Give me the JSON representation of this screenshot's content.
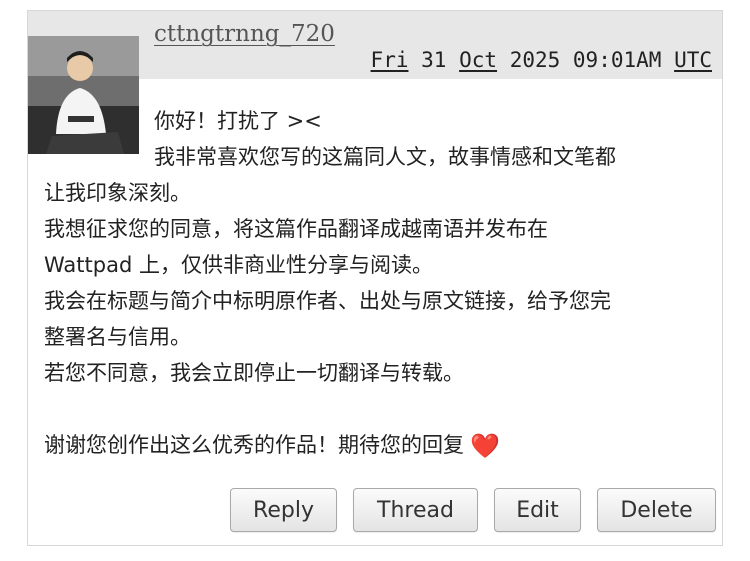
{
  "comment": {
    "username": "cttngtrnng_720",
    "timestamp": {
      "weekday": "Fri",
      "day": "31",
      "month": "Oct",
      "year_time": "2025 09:01AM",
      "zone": "UTC"
    },
    "avatar_icon": "user-photo-avatar",
    "body": {
      "line1": "你好！打扰了 ><",
      "line2": "我非常喜欢您写的这篇同人文，故事情感和文笔都",
      "line3": "让我印象深刻。",
      "line4": "我想征求您的同意，将这篇作品翻译成越南语并发布在",
      "line5": "Wattpad 上，仅供非商业性分享与阅读。",
      "line6": "我会在标题与简介中标明原作者、出处与原文链接，给予您完",
      "line7": "整署名与信用。",
      "line8": "若您不同意，我会立即停止一切翻译与转载。",
      "line9": "",
      "line10": "谢谢您创作出这么优秀的作品！期待您的回复",
      "heart": "❤️"
    },
    "actions": {
      "reply": "Reply",
      "thread": "Thread",
      "edit": "Edit",
      "delete": "Delete"
    }
  },
  "colors": {
    "header_band": "#e7e7e7",
    "border": "#d6d6d6",
    "heart": "#e0302a"
  }
}
